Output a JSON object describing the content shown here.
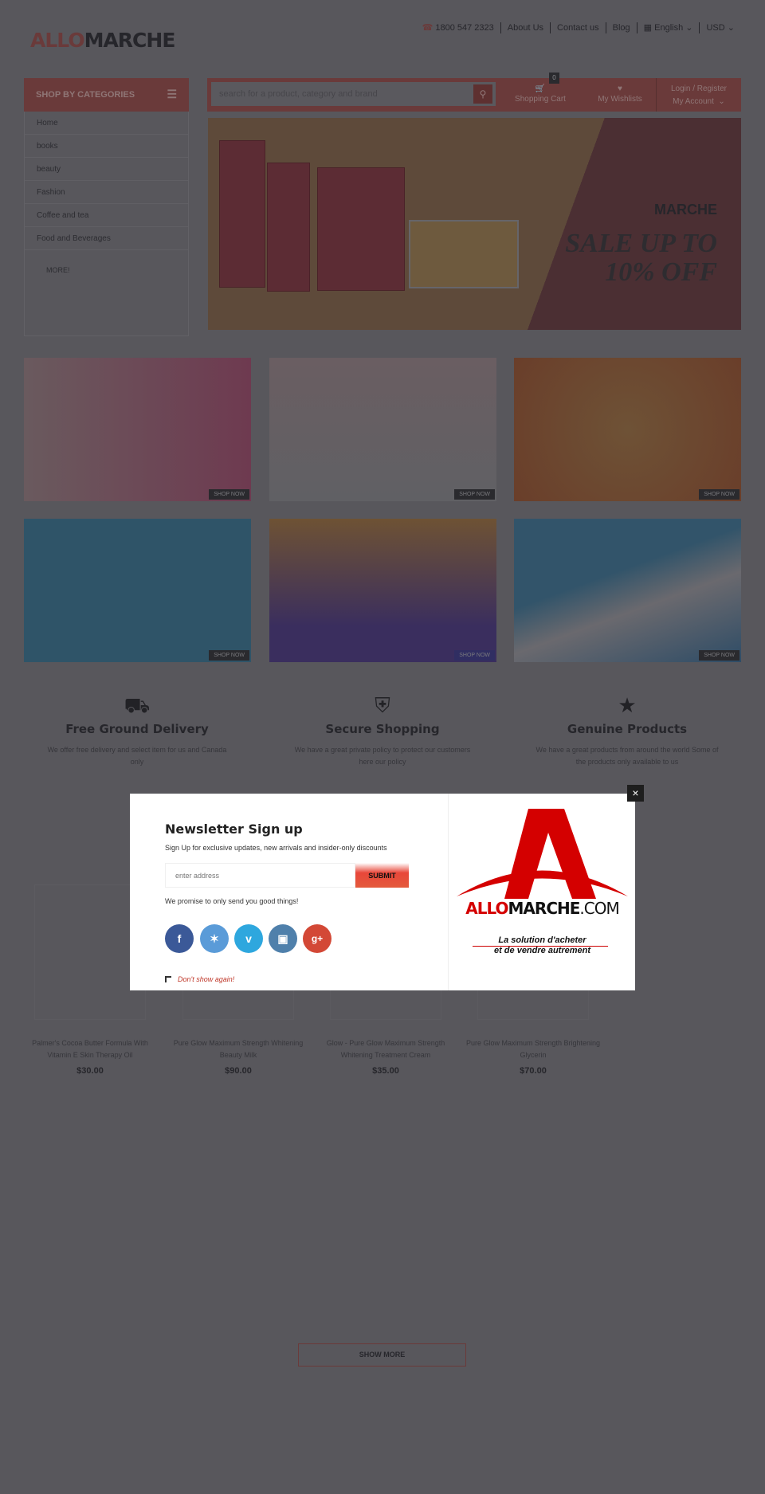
{
  "topbar": {
    "phone": "1800 547 2323",
    "links": [
      "About Us",
      "Contact us",
      "Blog"
    ],
    "language": "English",
    "currency": "USD"
  },
  "logo": {
    "part1": "ALLO",
    "part2": "MARCHE"
  },
  "categories": {
    "title": "SHOP BY CATEGORIES",
    "items": [
      "Home",
      "books",
      "beauty",
      "Fashion",
      "Coffee and tea",
      "Food and Beverages"
    ],
    "more": "MORE!"
  },
  "header": {
    "search_placeholder": "search for a product, category and brand",
    "cart_label": "Shopping Cart",
    "cart_count": "0",
    "wishlist_label": "My Wishlists",
    "login_label": "Login / Register",
    "account_label": "My Account"
  },
  "banner": {
    "brand": "MARCHE",
    "sale_line1": "SALE UP TO",
    "sale_line2": "10% OFF"
  },
  "tiles": {
    "shop_now": "SHOP NOW"
  },
  "features": [
    {
      "icon": "truck-icon",
      "title": "Free Ground Delivery",
      "text": "We offer free delivery and select item for us and Canada only"
    },
    {
      "icon": "shield-icon",
      "title": "Secure Shopping",
      "text": "We have a great private policy to protect our customers here our policy"
    },
    {
      "icon": "star-icon",
      "title": "Genuine Products",
      "text": "We have a great products from around the world Some of the products only available to us"
    }
  ],
  "products": [
    {
      "name": "Palmer's Cocoa Butter Formula With Vitamin E Skin Therapy Oil",
      "price": "$30.00"
    },
    {
      "name": "Pure Glow Maximum Strength Whitening Beauty Milk",
      "price": "$90.00"
    },
    {
      "name": "Glow - Pure Glow Maximum Strength Whitening Treatment Cream",
      "price": "$35.00"
    },
    {
      "name": "Pure Glow Maximum Strength Brightening Glycerin",
      "price": "$70.00"
    }
  ],
  "show_more": "SHOW MORE",
  "modal": {
    "title": "Newsletter Sign up",
    "subtitle": "Sign Up for exclusive updates, new arrivals and insider-only discounts",
    "email_placeholder": "enter address",
    "submit": "SUBMIT",
    "promise": "We promise to only send you good things!",
    "dont_show": "Don't show again!",
    "close": "×",
    "logo_word1": "ALLO",
    "logo_word2": "MARCHE",
    "logo_word3": ".COM",
    "tagline1": "La solution d'acheter",
    "tagline2": "et de vendre autrement"
  },
  "colors": {
    "accent": "#d93b2b",
    "overlay": "#58575c"
  }
}
